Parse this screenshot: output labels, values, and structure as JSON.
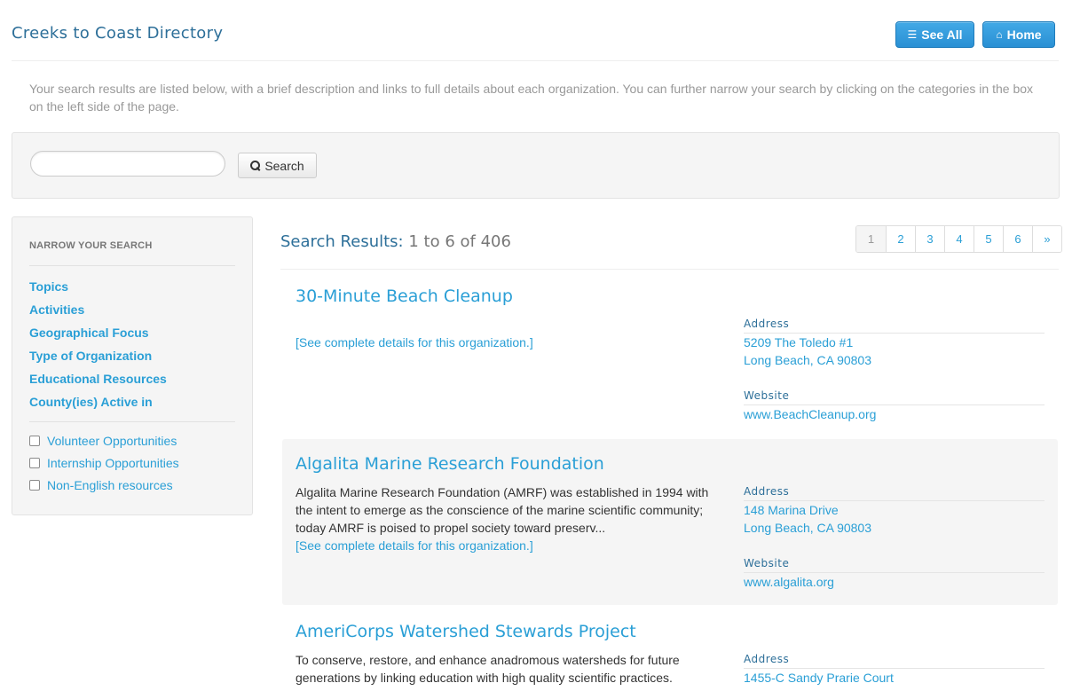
{
  "header": {
    "title": "Creeks to Coast Directory",
    "see_all_label": "See All",
    "home_label": "Home"
  },
  "intro": "Your search results are listed below, with a brief description and links to full details about each organization. You can further narrow your search by clicking on the categories in the box on the left side of the page.",
  "search": {
    "value": "",
    "placeholder": "",
    "button_label": "Search"
  },
  "sidebar": {
    "heading": "NARROW YOUR SEARCH",
    "links": [
      "Topics",
      "Activities",
      "Geographical Focus",
      "Type of Organization",
      "Educational Resources",
      "County(ies) Active in"
    ],
    "checkboxes": [
      {
        "label": "Volunteer Opportunities",
        "checked": false
      },
      {
        "label": "Internship Opportunities",
        "checked": false
      },
      {
        "label": "Non-English resources",
        "checked": false
      }
    ]
  },
  "results": {
    "title_label": "Search Results:",
    "range": "1 to 6 of 406",
    "pagination": [
      "1",
      "2",
      "3",
      "4",
      "5",
      "6",
      "»"
    ],
    "address_label": "Address",
    "website_label": "Website",
    "details_link": "[See complete details for this organization.]",
    "organizations": [
      {
        "name": "30-Minute Beach Cleanup",
        "description": "",
        "address_line1": "5209 The Toledo #1",
        "address_line2": "Long Beach, CA 90803",
        "website": "www.BeachCleanup.org"
      },
      {
        "name": "Algalita Marine Research Foundation",
        "description": "Algalita Marine Research Foundation (AMRF) was established in 1994 with the intent to emerge as the conscience of the marine scientific community; today AMRF is poised to propel society toward preserv...",
        "address_line1": "148 Marina Drive",
        "address_line2": "Long Beach, CA 90803",
        "website": "www.algalita.org"
      },
      {
        "name": "AmeriCorps Watershed Stewards Project",
        "description": "To conserve, restore, and enhance anadromous watersheds for future generations by linking education with high quality scientific practices.",
        "address_line1": "1455-C Sandy Prarie Court",
        "address_line2": "",
        "website": ""
      }
    ]
  },
  "colors": {
    "accent": "#2a9fd6",
    "heading": "#2d6f99",
    "muted": "#999999",
    "panel": "#f5f5f5"
  }
}
